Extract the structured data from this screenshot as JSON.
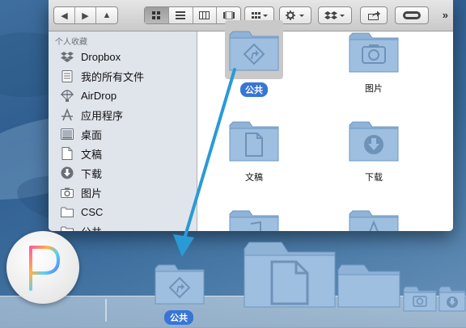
{
  "sidebar": {
    "header": "个人收藏",
    "items": [
      {
        "label": "Dropbox",
        "icon": "dropbox-icon"
      },
      {
        "label": "我的所有文件",
        "icon": "all-files-icon"
      },
      {
        "label": "AirDrop",
        "icon": "airdrop-icon"
      },
      {
        "label": "应用程序",
        "icon": "applications-icon"
      },
      {
        "label": "桌面",
        "icon": "desktop-icon"
      },
      {
        "label": "文稿",
        "icon": "documents-icon"
      },
      {
        "label": "下载",
        "icon": "downloads-icon"
      },
      {
        "label": "图片",
        "icon": "pictures-icon"
      },
      {
        "label": "CSC",
        "icon": "folder-icon"
      },
      {
        "label": "公共",
        "icon": "public-folder-icon"
      }
    ]
  },
  "toolbar": {
    "back": "◀",
    "forward": "▶",
    "eject": "▲",
    "view_icon": "icon-view-icon",
    "view_list": "list-view-icon",
    "view_column": "column-view-icon",
    "view_coverflow": "coverflow-view-icon",
    "overflow": "»"
  },
  "files": [
    {
      "label": "公共",
      "icon": "public-folder-icon",
      "selected": true
    },
    {
      "label": "图片",
      "icon": "pictures-folder-icon",
      "selected": false
    },
    {
      "label": "文稿",
      "icon": "documents-folder-icon",
      "selected": false
    },
    {
      "label": "下载",
      "icon": "downloads-folder-icon",
      "selected": false
    },
    {
      "label": "",
      "icon": "music-folder-icon",
      "selected": false
    },
    {
      "label": "",
      "icon": "applications-folder-icon",
      "selected": false
    }
  ],
  "dock": {
    "dragged_label": "公共",
    "colors": {
      "selection": "#3875d7",
      "folder": "#8fb3d7"
    }
  }
}
